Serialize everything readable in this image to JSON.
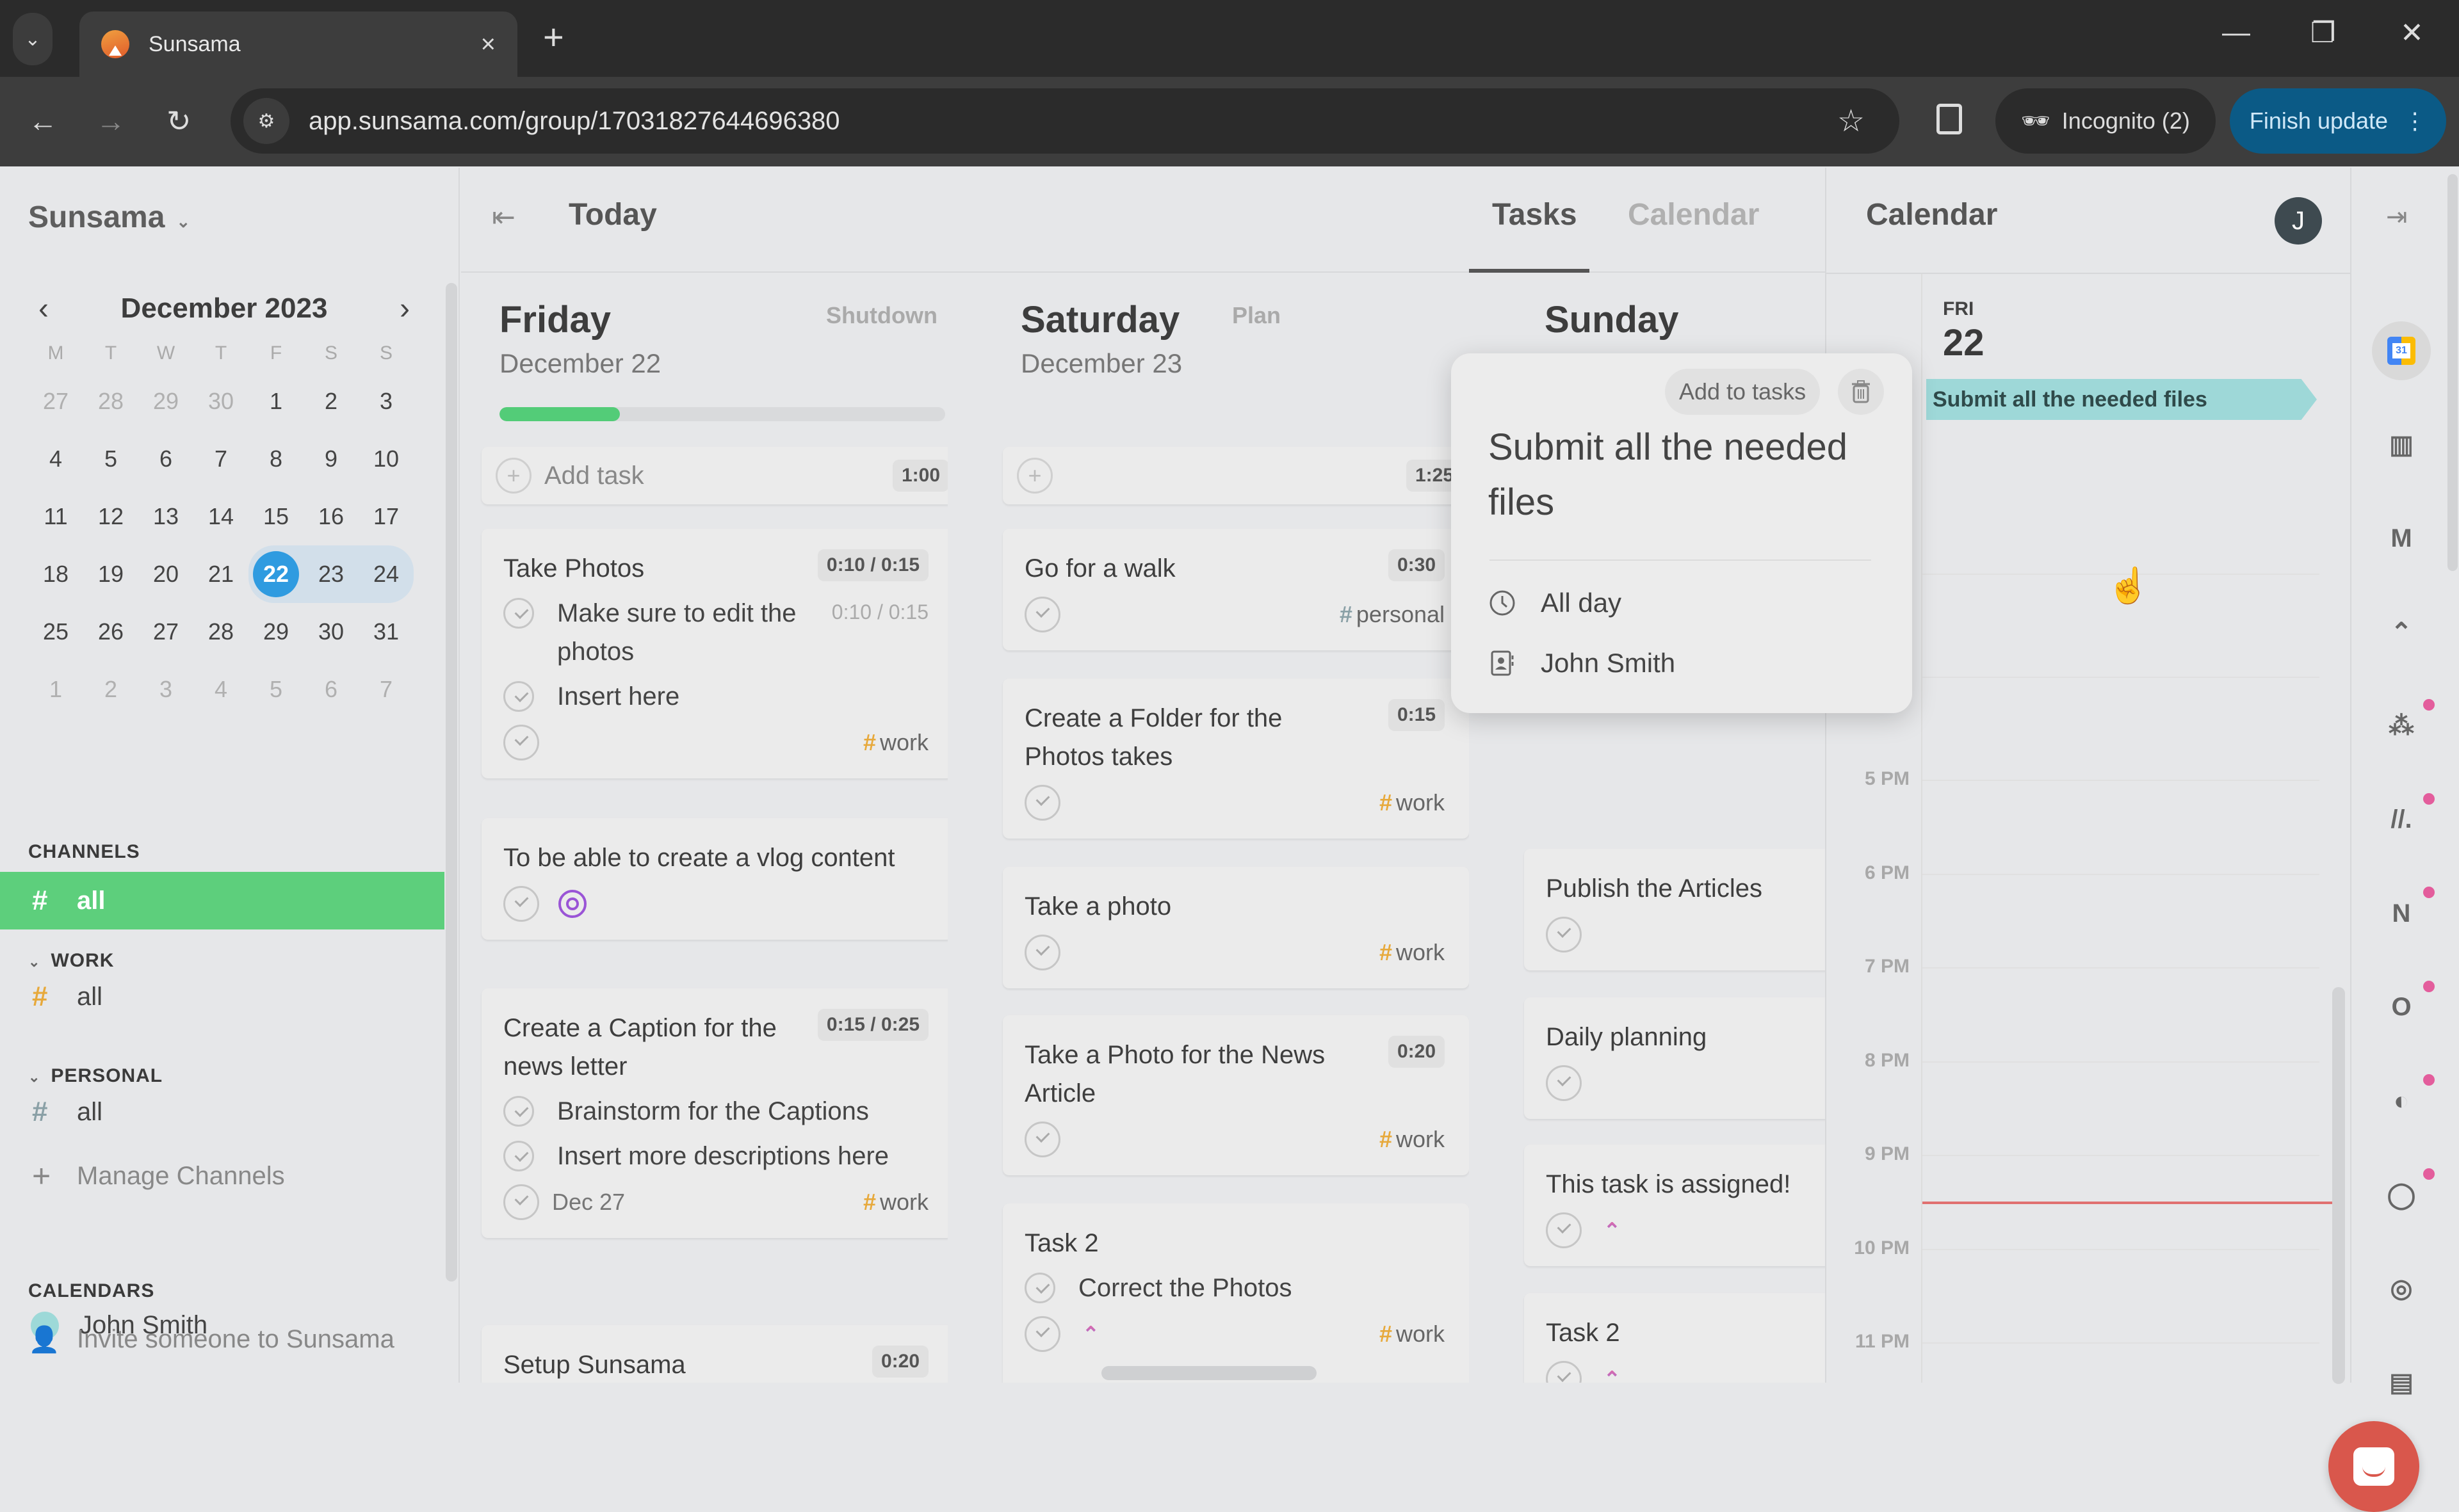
{
  "browser": {
    "tab_title": "Sunsama",
    "url": "app.sunsama.com/group/17031827644696380",
    "incognito_label": "Incognito (2)",
    "finish_update_label": "Finish update"
  },
  "sidebar": {
    "workspace": "Sunsama",
    "mini_calendar": {
      "month_label": "December 2023",
      "weekdays": [
        "M",
        "T",
        "W",
        "T",
        "F",
        "S",
        "S"
      ],
      "weeks": [
        [
          {
            "d": "27",
            "m": 1
          },
          {
            "d": "28",
            "m": 1
          },
          {
            "d": "29",
            "m": 1
          },
          {
            "d": "30",
            "m": 1
          },
          {
            "d": "1"
          },
          {
            "d": "2"
          },
          {
            "d": "3"
          }
        ],
        [
          {
            "d": "4"
          },
          {
            "d": "5"
          },
          {
            "d": "6"
          },
          {
            "d": "7"
          },
          {
            "d": "8"
          },
          {
            "d": "9"
          },
          {
            "d": "10"
          }
        ],
        [
          {
            "d": "11"
          },
          {
            "d": "12"
          },
          {
            "d": "13"
          },
          {
            "d": "14"
          },
          {
            "d": "15"
          },
          {
            "d": "16"
          },
          {
            "d": "17"
          }
        ],
        [
          {
            "d": "18"
          },
          {
            "d": "19"
          },
          {
            "d": "20"
          },
          {
            "d": "21"
          },
          {
            "d": "22",
            "sel": 1
          },
          {
            "d": "23"
          },
          {
            "d": "24"
          }
        ],
        [
          {
            "d": "25"
          },
          {
            "d": "26"
          },
          {
            "d": "27"
          },
          {
            "d": "28"
          },
          {
            "d": "29"
          },
          {
            "d": "30"
          },
          {
            "d": "31"
          }
        ],
        [
          {
            "d": "1",
            "m": 1
          },
          {
            "d": "2",
            "m": 1
          },
          {
            "d": "3",
            "m": 1
          },
          {
            "d": "4",
            "m": 1
          },
          {
            "d": "5",
            "m": 1
          },
          {
            "d": "6",
            "m": 1
          },
          {
            "d": "7",
            "m": 1
          }
        ]
      ],
      "selected_day": "22"
    },
    "channels_label": "CHANNELS",
    "channels_all": "all",
    "work_label": "WORK",
    "work_all": "all",
    "personal_label": "PERSONAL",
    "personal_all": "all",
    "manage_channels": "Manage Channels",
    "calendars_label": "CALENDARS",
    "calendar_user": "John Smith",
    "invite": "Invite someone to Sunsama"
  },
  "main": {
    "header": "Today",
    "tabs": {
      "tasks": "Tasks",
      "calendar": "Calendar"
    },
    "days": [
      {
        "name": "Friday",
        "date": "December 22",
        "action": "Shutdown",
        "progress": 0.27,
        "add_task_label": "Add task",
        "total": "1:00",
        "tasks": [
          {
            "title": "Take Photos",
            "time": "0:10 / 0:15",
            "subtasks": [
              {
                "title": "Make sure to edit the photos",
                "time": "0:10 / 0:15"
              },
              {
                "title": "Insert here"
              }
            ],
            "tag": "work"
          },
          {
            "title": "To be able to create a vlog content",
            "icon": "target-icon"
          },
          {
            "title": "Create a Caption for the news letter",
            "time": "0:15 / 0:25",
            "subtasks": [
              {
                "title": "Brainstorm for the Captions"
              },
              {
                "title": "Insert more descriptions here"
              }
            ],
            "due": "Dec 27",
            "tag": "work"
          },
          {
            "title": "Setup Sunsama",
            "time": "0:20"
          }
        ]
      },
      {
        "name": "Saturday",
        "date": "December 23",
        "action": "Plan",
        "total": "1:25",
        "tasks": [
          {
            "title": "Go for a walk",
            "time": "0:30",
            "tag": "personal"
          },
          {
            "title": "Create a Folder for the Photos takes",
            "time": "0:15",
            "tag": "work"
          },
          {
            "title": "Take a photo",
            "tag": "work"
          },
          {
            "title": "Take a Photo for the News Article",
            "time": "0:20",
            "tag": "work"
          },
          {
            "title": "Task 2",
            "subtasks": [
              {
                "title": "Correct the Photos"
              }
            ],
            "tag": "work",
            "icon": "clickup-icon"
          }
        ]
      },
      {
        "name": "Sunday",
        "tasks": [
          {
            "title": "Publish the Articles"
          },
          {
            "title": "Daily planning"
          },
          {
            "title": "This task is assigned!",
            "icon": "clickup-icon"
          },
          {
            "title": "Task 2",
            "icon": "clickup-icon"
          }
        ]
      }
    ]
  },
  "popover": {
    "add_to_tasks": "Add to tasks",
    "title": "Submit all the needed files",
    "when": "All day",
    "calendar": "John Smith"
  },
  "calendar_pane": {
    "title": "Calendar",
    "avatar_initial": "J",
    "day_of_week": "FRI",
    "day_of_month": "22",
    "all_day_event": "Submit all the needed files",
    "event_color": "#9ed8d8",
    "hours": [
      "5 PM",
      "6 PM",
      "7 PM",
      "8 PM",
      "9 PM",
      "10 PM",
      "11 PM"
    ],
    "now_time_hours": 21.5
  },
  "rail": {
    "integrations": [
      "google-calendar-icon",
      "trello-icon",
      "gmail-icon",
      "clickup-icon",
      "asana-icon",
      "monday-icon",
      "notion-icon",
      "outlook-icon",
      "linear-icon",
      "github-icon",
      "target-icon",
      "archive-icon"
    ],
    "notified": [
      false,
      false,
      false,
      false,
      true,
      true,
      true,
      true,
      true,
      true,
      false,
      false
    ]
  },
  "colors": {
    "accent_green": "#5dcf7c",
    "selected_day_blue": "#2f9be0",
    "work_tag": "#e7a93b",
    "chat_button": "#d9574c"
  }
}
